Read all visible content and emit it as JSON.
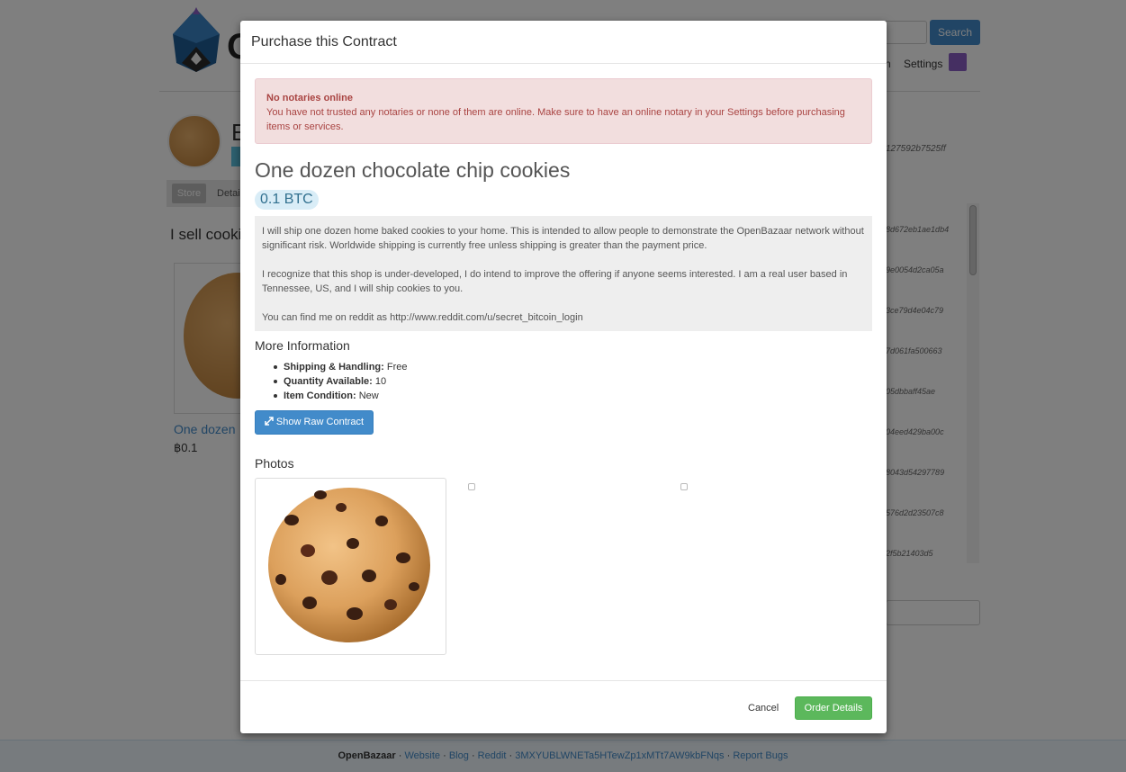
{
  "header": {
    "search_label": "Search",
    "nav_settings": "Settings",
    "nav_fragment": "n"
  },
  "store": {
    "name_fragment": "E",
    "guid_fragment": "127592b7525ff",
    "tab_store": "Store",
    "tab_details": "Detai",
    "tagline_fragment": "I sell cooki"
  },
  "store_item": {
    "title_fragment": "One dozen",
    "price": "฿0.1"
  },
  "guid_list": [
    "8d672eb1ae1db4",
    "9e0054d2ca05a",
    "3ce79d4e04c79",
    "7d061fa500663",
    "05dbbaff45ae",
    "04eed429ba00c",
    "8043d54297789",
    "576d2d23507c8",
    "2f5b21403d5"
  ],
  "footer": {
    "brand": "OpenBazaar",
    "website": "Website",
    "blog": "Blog",
    "reddit": "Reddit",
    "address": "3MXYUBLWNETa5HTewZp1xMTt7AW9kbFNqs",
    "report": "Report Bugs",
    "separator": "·"
  },
  "modal": {
    "title": "Purchase this Contract",
    "alert": {
      "title": "No notaries online",
      "message": "You have not trusted any notaries or none of them are online. Make sure to have an online notary in your Settings before purchasing items or services."
    },
    "product_title": "One dozen chocolate chip cookies",
    "price": "0.1 BTC",
    "description": [
      "I will ship one dozen home baked cookies to your home. This is intended to allow people to demonstrate the OpenBazaar network without significant risk. Worldwide shipping is currently free unless shipping is greater than the payment price.",
      "I recognize that this shop is under-developed, I do intend to improve the offering if anyone seems interested. I am a real user based in Tennessee, US, and I will ship cookies to you.",
      "You can find me on reddit as http://www.reddit.com/u/secret_bitcoin_login"
    ],
    "more_info_heading": "More Information",
    "info": [
      {
        "label": "Shipping & Handling:",
        "value": "Free"
      },
      {
        "label": "Quantity Available:",
        "value": "10"
      },
      {
        "label": "Item Condition:",
        "value": "New"
      }
    ],
    "raw_contract_button": "Show Raw Contract",
    "photos_heading": "Photos",
    "cancel": "Cancel",
    "order_button": "Order Details"
  },
  "colors": {
    "primary": "#428bca",
    "success": "#5cb85c",
    "danger_bg": "#f2dede",
    "danger_text": "#a94442",
    "info_bg": "#d9edf7"
  }
}
